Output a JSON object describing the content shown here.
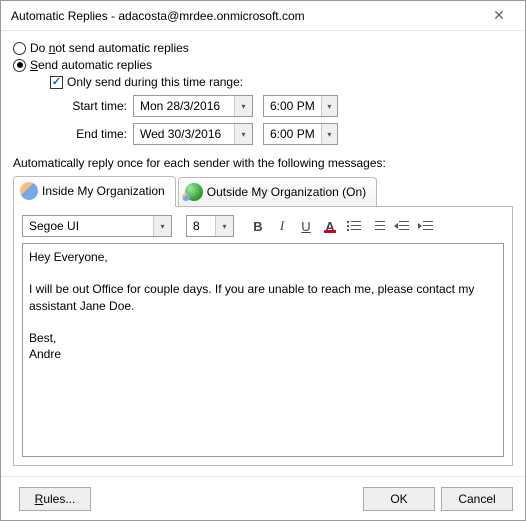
{
  "title": "Automatic Replies - adacosta@mrdee.onmicrosoft.com",
  "options": {
    "do_not_send_label_pre": "Do ",
    "do_not_send_label_u": "n",
    "do_not_send_label_post": "ot send automatic replies",
    "send_label_u": "S",
    "send_label_post": "end automatic replies",
    "only_send_label": "Only send during this time range:",
    "selected": "send",
    "only_send_checked": true
  },
  "range": {
    "start_label": "Start time:",
    "end_label": "End time:",
    "start_date": "Mon 28/3/2016",
    "start_time": "6:00 PM",
    "end_date": "Wed 30/3/2016",
    "end_time": "6:00 PM"
  },
  "tabs": {
    "prompt": "Automatically reply once for each sender with the following messages:",
    "inside_label": "Inside My Organization",
    "outside_label": "Outside My Organization (On)",
    "active": "inside"
  },
  "editor_toolbar": {
    "font_name": "Segoe UI",
    "font_size": "8"
  },
  "message_body": "Hey Everyone,\n\nI will be out Office for couple days. If you are unable to reach me, please contact my assistant Jane Doe.\n\nBest,\nAndre",
  "footer": {
    "rules_label": "Rules...",
    "ok_label": "OK",
    "cancel_label": "Cancel"
  }
}
